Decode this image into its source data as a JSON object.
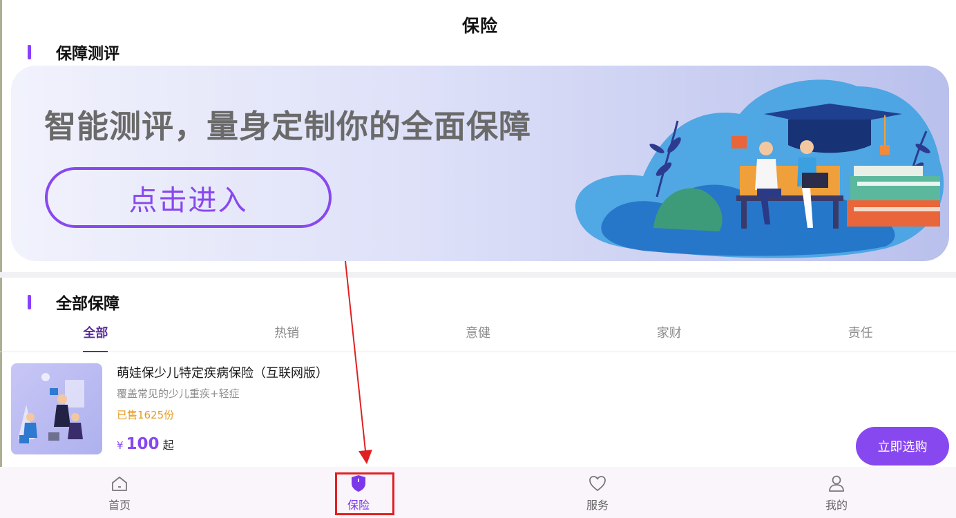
{
  "header": {
    "title": "保险"
  },
  "section_evaluation": {
    "title": "保障测评"
  },
  "banner": {
    "slogan": "智能测评，量身定制你的全面保障",
    "button_label": "点击进入"
  },
  "section_all": {
    "title": "全部保障"
  },
  "tabs": [
    {
      "label": "全部",
      "active": true
    },
    {
      "label": "热销",
      "active": false
    },
    {
      "label": "意健",
      "active": false
    },
    {
      "label": "家财",
      "active": false
    },
    {
      "label": "责任",
      "active": false
    }
  ],
  "products": [
    {
      "name": "萌娃保少儿特定疾病保险（互联网版）",
      "description": "覆盖常见的少儿重疾+轻症",
      "sold": "已售1625份",
      "currency": "¥",
      "price": "100",
      "price_suffix": "起",
      "button_label": "立即选购"
    }
  ],
  "bottom_nav": [
    {
      "label": "首页",
      "icon": "home-icon",
      "active": false
    },
    {
      "label": "保险",
      "icon": "shield-icon",
      "active": true
    },
    {
      "label": "服务",
      "icon": "heart-icon",
      "active": false
    },
    {
      "label": "我的",
      "icon": "user-icon",
      "active": false
    }
  ],
  "colors": {
    "accent": "#8848ef",
    "sold": "#e49a1f",
    "highlight": "#e02020",
    "nav_bg": "#faf4fb"
  }
}
